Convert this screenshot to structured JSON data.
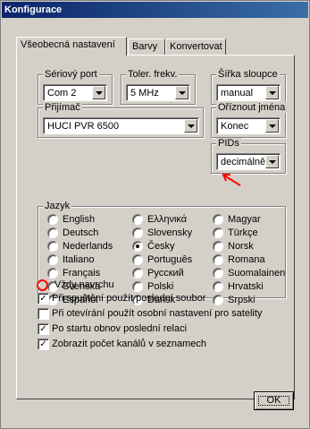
{
  "window": {
    "title": "Konfigurace"
  },
  "tabs": [
    {
      "label": "Všeobecná nastavení",
      "active": true
    },
    {
      "label": "Barvy",
      "active": false
    },
    {
      "label": "Konvertovat",
      "active": false
    }
  ],
  "serial_port": {
    "label": "Sériový port",
    "value": "Com 2"
  },
  "freq_tolerance": {
    "label": "Toler. frekv.",
    "value": "5 MHz"
  },
  "column_width": {
    "label": "Šířka sloupce",
    "value": "manual"
  },
  "receiver": {
    "label": "Přijímač",
    "value": "HUCI PVR 6500"
  },
  "trim_names": {
    "label": "Oříznout jména",
    "value": "Konec"
  },
  "pids": {
    "label": "PIDs",
    "value": "decimálně"
  },
  "language": {
    "label": "Jazyk",
    "selected": "Česky",
    "options": [
      [
        "English",
        "Ελληνικά",
        "Magyar"
      ],
      [
        "Deutsch",
        "Slovensky",
        "Türkçe"
      ],
      [
        "Nederlands",
        "Česky",
        "Norsk"
      ],
      [
        "Italiano",
        "Português",
        "Romana"
      ],
      [
        "Français",
        "Русский",
        "Suomalainen"
      ],
      [
        "Svenska",
        "Polski",
        "Hrvatski"
      ],
      [
        "Español",
        "Dansk",
        "Srpski"
      ]
    ]
  },
  "options": [
    {
      "label": "Vždy navrchu",
      "checked": false,
      "highlighted": true
    },
    {
      "label": "Při spuštění použít poslední soubor",
      "checked": true
    },
    {
      "label": "Při otevírání použít osobní nastavení pro satelity",
      "checked": false
    },
    {
      "label": "Po startu obnov poslední relaci",
      "checked": true
    },
    {
      "label": "Zobrazit počet kanálů v seznamech",
      "checked": true
    }
  ],
  "buttons": {
    "ok": "OK"
  },
  "colors": {
    "titlebar_start": "#0a246a",
    "titlebar_end": "#3a6ea5",
    "face": "#d4d0c8",
    "annotation": "#ff0000"
  }
}
